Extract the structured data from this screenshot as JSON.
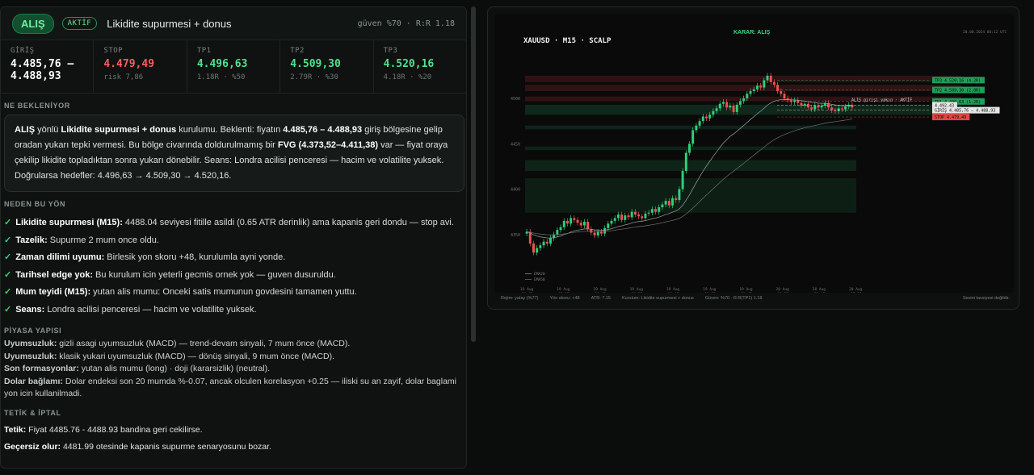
{
  "header": {
    "direction": "ALIŞ",
    "badge": "AKTİF",
    "title": "Likidite supurmesi + donus",
    "right": "güven %70 · R:R 1.18"
  },
  "levels": [
    {
      "label": "GİRİŞ",
      "value": "4.485,76 –\n4.488,93",
      "sub": "",
      "color": "#ffffff"
    },
    {
      "label": "STOP",
      "value": "4.479,49",
      "sub": "risk 7,86",
      "color": "#ff5b5b"
    },
    {
      "label": "TP1",
      "value": "4.496,63",
      "sub": "1.18R · %50",
      "color": "#4ee38d"
    },
    {
      "label": "TP2",
      "value": "4.509,30",
      "sub": "2.79R · %30",
      "color": "#4ee38d"
    },
    {
      "label": "TP3",
      "value": "4.520,16",
      "sub": "4.18R · %20",
      "color": "#4ee38d"
    }
  ],
  "expect": {
    "title": "NE BEKLENİYOR",
    "p1": "ALIŞ",
    "p2": " yönlü ",
    "p3": "Likidite supurmesi + donus",
    "p4": " kurulumu. Beklenti: fiyatın ",
    "p5": "4.485,76 – 4.488,93",
    "p6": " giriş bölgesine gelip oradan yukarı tepki vermesi. Bu bölge civarında doldurulmamış bir ",
    "p7": "FVG (4.373,52–4.411,38)",
    "p8": " var — fiyat oraya çekilip likidite topladıktan sonra yukarı dönebilir. Seans: Londra acilisi penceresi — hacim ve volatilite yuksek. Doğrularsa hedefler: 4.496,63 → 4.509,30 → 4.520,16."
  },
  "why": {
    "title": "NEDEN BU YÖN",
    "items": [
      {
        "head": "Likidite supurmesi (M15):",
        "text": " 4488.04 seviyesi fitille asildi (0.65 ATR derinlik) ama kapanis geri dondu — stop avi."
      },
      {
        "head": "Tazelik:",
        "text": " Supurme 2 mum once oldu."
      },
      {
        "head": "Zaman dilimi uyumu:",
        "text": " Birlesik yon skoru +48, kurulumla ayni yonde."
      },
      {
        "head": "Tarihsel edge yok:",
        "text": " Bu kurulum icin yeterli gecmis ornek yok — guven dusuruldu."
      },
      {
        "head": "Mum teyidi (M15):",
        "text": " yutan alis mumu: Onceki satis mumunun govdesini tamamen yuttu."
      },
      {
        "head": "Seans:",
        "text": " Londra acilisi penceresi — hacim ve volatilite yuksek."
      }
    ]
  },
  "market": {
    "title": "PİYASA YAPISI",
    "items": [
      {
        "head": "Uyumsuzluk:",
        "text": " gizli asagi uyumsuzluk (MACD) — trend-devam sinyali, 7 mum önce (MACD)."
      },
      {
        "head": "Uyumsuzluk:",
        "text": " klasik yukari uyumsuzluk (MACD) — dönüş sinyali, 9 mum önce (MACD)."
      },
      {
        "head": "Son formasyonlar:",
        "text": " yutan alis mumu (long) · doji (kararsizlik) (neutral)."
      },
      {
        "head": "Dolar bağlamı:",
        "text": " Dolar endeksi son 20 mumda %-0.07, ancak olculen korelasyon +0.25 — iliski su an zayif, dolar baglami yon icin kullanilmadi."
      }
    ]
  },
  "trigger": {
    "title": "TETİK & İPTAL",
    "items": [
      {
        "head": "Tetik:",
        "text": "  Fiyat 4485.76 - 4488.93 bandina geri cekilirse."
      },
      {
        "head": "Geçersiz olur:",
        "text": "  4481.99 otesinde kapanis supurme senaryosunu bozar."
      }
    ]
  },
  "chart_data": {
    "type": "candlestick",
    "symbol": "XAUUSD",
    "timeframe": "M15",
    "mode": "SCALP",
    "decision": "KARAR: ALIŞ",
    "timestamp": "20.08.2024 08:12 UTC",
    "ylim": [
      4300,
      4540
    ],
    "yticks": [
      4350,
      4400,
      4450,
      4500
    ],
    "xticks": [
      "16 Aug\n19:45",
      "19 Aug\n03:15",
      "19 Aug\n10:45",
      "19 Aug\n18:15",
      "19 Aug\n11:45",
      "19 Aug\n15:15",
      "19 Aug\n18:45",
      "20 Aug\n00:15",
      "20 Aug\n03:45",
      "20 Aug\n07:15"
    ],
    "legend": [
      "EMA20",
      "EMA50"
    ],
    "closes": [
      4353,
      4340,
      4330,
      4335,
      4338,
      4342,
      4340,
      4346,
      4350,
      4355,
      4358,
      4365,
      4362,
      4368,
      4366,
      4363,
      4360,
      4364,
      4356,
      4352,
      4349,
      4353,
      4351,
      4357,
      4362,
      4365,
      4368,
      4372,
      4366,
      4371,
      4369,
      4375,
      4372,
      4370,
      4368,
      4373,
      4374,
      4378,
      4375,
      4380,
      4383,
      4387,
      4382,
      4390,
      4388,
      4400,
      4420,
      4440,
      4450,
      4465,
      4470,
      4475,
      4480,
      4478,
      4482,
      4486,
      4489,
      4494,
      4496,
      4490,
      4492,
      4485,
      4493,
      4497,
      4500,
      4505,
      4508,
      4510,
      4514,
      4512,
      4520,
      4525,
      4518,
      4515,
      4508,
      4505,
      4500,
      4498,
      4496,
      4498,
      4495,
      4492,
      4494,
      4490,
      4488,
      4492,
      4490,
      4492,
      4495,
      4490,
      4487,
      4486,
      4489,
      4488,
      4491,
      4493,
      4490
    ],
    "tags": [
      {
        "text": "TP3 4.520,16 (4.2R)",
        "color": "#2fd07a"
      },
      {
        "text": "TP2 4.509,30 (2.8R)",
        "color": "#2fd07a"
      },
      {
        "text": "TP1 4.496,63 (1.2R)",
        "color": "#2fd07a"
      },
      {
        "text": "4.492,43",
        "color": "#ffffff"
      },
      {
        "text": "GİRİŞ 4.485,76 – 4.488,93",
        "color": "#ffffff"
      },
      {
        "text": "STOP 4.479,49",
        "color": "#ff5b5b"
      }
    ],
    "mid_label": "ALIŞ girişi yakın · AKTİF",
    "footer": [
      "Rejim: yatay (%77)",
      "Yön skoru: +48",
      "ATR: 7.15",
      "Kurulum: Likidite supurmesi + donus",
      "Güven: %70 · R:R(TP1) 1.18"
    ],
    "footer_right": "Sesini tavsiyesi değildir."
  }
}
